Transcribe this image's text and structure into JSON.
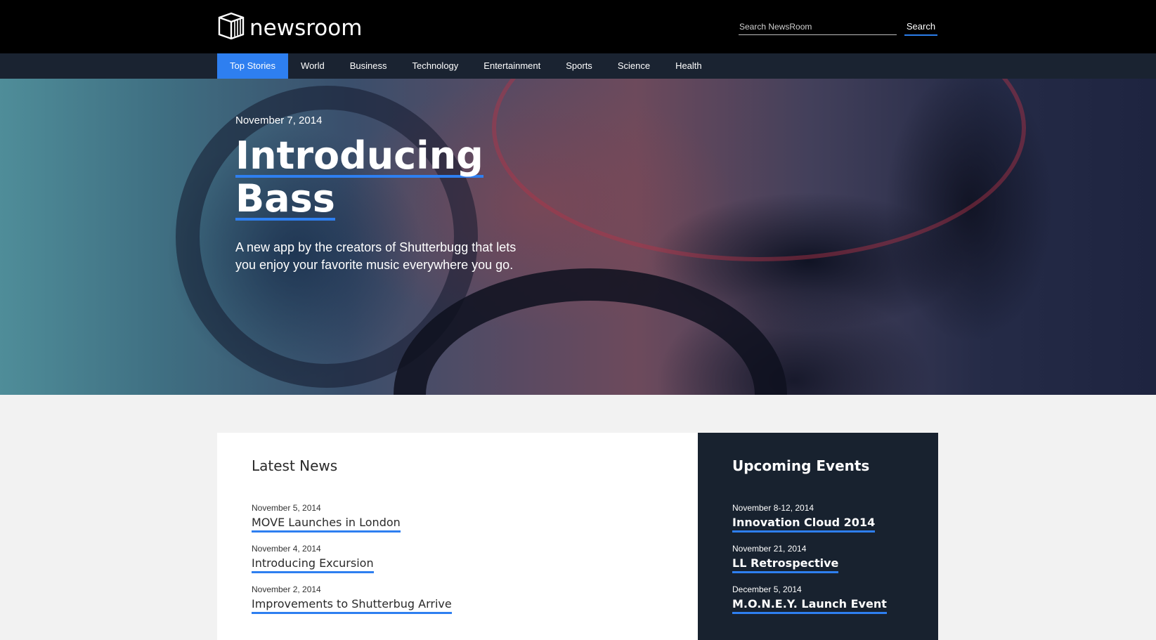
{
  "header": {
    "logo_text": "newsroom",
    "search_placeholder": "Search NewsRoom",
    "search_button": "Search"
  },
  "nav": {
    "items": [
      {
        "label": "Top Stories",
        "active": true
      },
      {
        "label": "World"
      },
      {
        "label": "Business"
      },
      {
        "label": "Technology"
      },
      {
        "label": "Entertainment"
      },
      {
        "label": "Sports"
      },
      {
        "label": "Science"
      },
      {
        "label": "Health"
      }
    ]
  },
  "hero": {
    "date": "November 7, 2014",
    "title_line1": "Introducing",
    "title_line2": "Bass",
    "subtitle": "A new app by the creators of Shutterbugg that lets you enjoy your favorite music everywhere you go."
  },
  "latest_news": {
    "heading": "Latest News",
    "items": [
      {
        "date": "November 5, 2014",
        "title": "MOVE Launches in London"
      },
      {
        "date": "November 4, 2014",
        "title": "Introducing Excursion"
      },
      {
        "date": "November 2, 2014",
        "title": "Improvements to Shutterbug Arrive"
      }
    ]
  },
  "upcoming_events": {
    "heading": "Upcoming Events",
    "items": [
      {
        "date": "November 8-12, 2014",
        "title": "Innovation Cloud 2014"
      },
      {
        "date": "November 21, 2014",
        "title": "LL Retrospective"
      },
      {
        "date": "December 5, 2014",
        "title": "M.O.N.E.Y. Launch Event"
      }
    ]
  },
  "colors": {
    "accent": "#2e7ff0",
    "header_bg": "#000000",
    "nav_bg": "#1a2331",
    "events_bg": "#18222f",
    "page_bg": "#f2f2f2"
  }
}
